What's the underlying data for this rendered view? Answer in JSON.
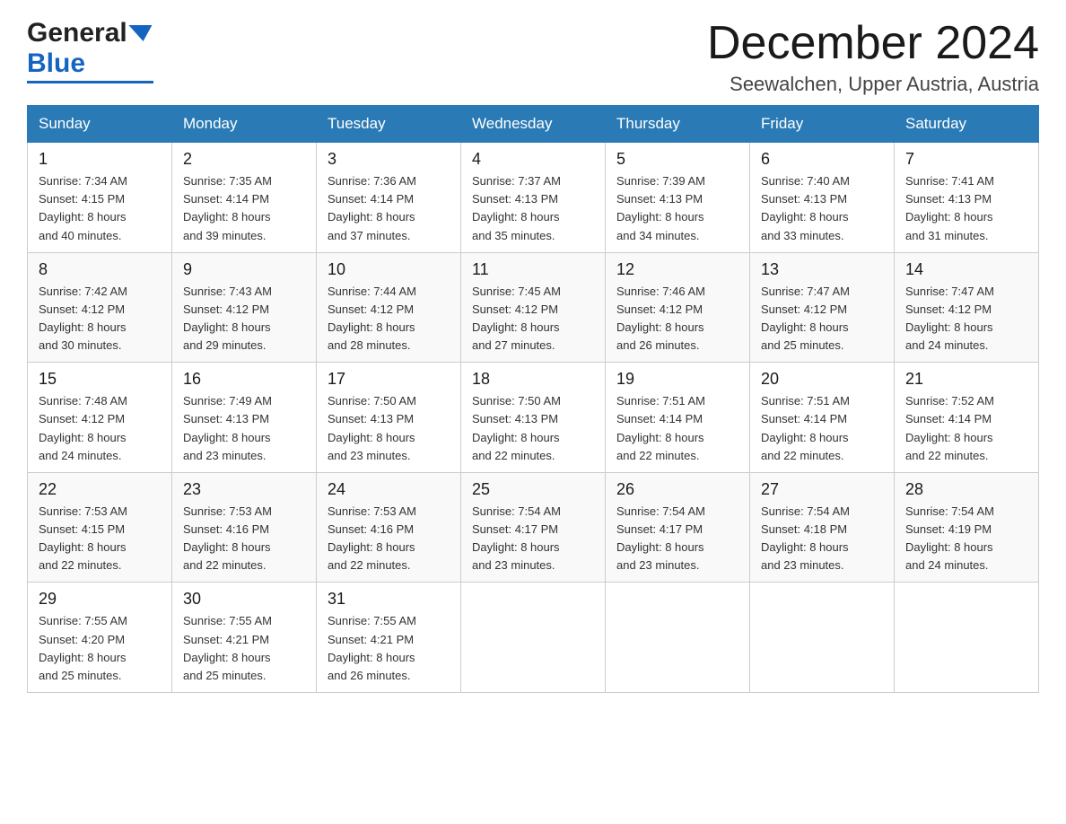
{
  "header": {
    "month_title": "December 2024",
    "location": "Seewalchen, Upper Austria, Austria",
    "logo_general": "General",
    "logo_blue": "Blue"
  },
  "weekdays": [
    "Sunday",
    "Monday",
    "Tuesday",
    "Wednesday",
    "Thursday",
    "Friday",
    "Saturday"
  ],
  "weeks": [
    [
      {
        "day": "1",
        "sunrise": "7:34 AM",
        "sunset": "4:15 PM",
        "daylight": "8 hours and 40 minutes."
      },
      {
        "day": "2",
        "sunrise": "7:35 AM",
        "sunset": "4:14 PM",
        "daylight": "8 hours and 39 minutes."
      },
      {
        "day": "3",
        "sunrise": "7:36 AM",
        "sunset": "4:14 PM",
        "daylight": "8 hours and 37 minutes."
      },
      {
        "day": "4",
        "sunrise": "7:37 AM",
        "sunset": "4:13 PM",
        "daylight": "8 hours and 35 minutes."
      },
      {
        "day": "5",
        "sunrise": "7:39 AM",
        "sunset": "4:13 PM",
        "daylight": "8 hours and 34 minutes."
      },
      {
        "day": "6",
        "sunrise": "7:40 AM",
        "sunset": "4:13 PM",
        "daylight": "8 hours and 33 minutes."
      },
      {
        "day": "7",
        "sunrise": "7:41 AM",
        "sunset": "4:13 PM",
        "daylight": "8 hours and 31 minutes."
      }
    ],
    [
      {
        "day": "8",
        "sunrise": "7:42 AM",
        "sunset": "4:12 PM",
        "daylight": "8 hours and 30 minutes."
      },
      {
        "day": "9",
        "sunrise": "7:43 AM",
        "sunset": "4:12 PM",
        "daylight": "8 hours and 29 minutes."
      },
      {
        "day": "10",
        "sunrise": "7:44 AM",
        "sunset": "4:12 PM",
        "daylight": "8 hours and 28 minutes."
      },
      {
        "day": "11",
        "sunrise": "7:45 AM",
        "sunset": "4:12 PM",
        "daylight": "8 hours and 27 minutes."
      },
      {
        "day": "12",
        "sunrise": "7:46 AM",
        "sunset": "4:12 PM",
        "daylight": "8 hours and 26 minutes."
      },
      {
        "day": "13",
        "sunrise": "7:47 AM",
        "sunset": "4:12 PM",
        "daylight": "8 hours and 25 minutes."
      },
      {
        "day": "14",
        "sunrise": "7:47 AM",
        "sunset": "4:12 PM",
        "daylight": "8 hours and 24 minutes."
      }
    ],
    [
      {
        "day": "15",
        "sunrise": "7:48 AM",
        "sunset": "4:12 PM",
        "daylight": "8 hours and 24 minutes."
      },
      {
        "day": "16",
        "sunrise": "7:49 AM",
        "sunset": "4:13 PM",
        "daylight": "8 hours and 23 minutes."
      },
      {
        "day": "17",
        "sunrise": "7:50 AM",
        "sunset": "4:13 PM",
        "daylight": "8 hours and 23 minutes."
      },
      {
        "day": "18",
        "sunrise": "7:50 AM",
        "sunset": "4:13 PM",
        "daylight": "8 hours and 22 minutes."
      },
      {
        "day": "19",
        "sunrise": "7:51 AM",
        "sunset": "4:14 PM",
        "daylight": "8 hours and 22 minutes."
      },
      {
        "day": "20",
        "sunrise": "7:51 AM",
        "sunset": "4:14 PM",
        "daylight": "8 hours and 22 minutes."
      },
      {
        "day": "21",
        "sunrise": "7:52 AM",
        "sunset": "4:14 PM",
        "daylight": "8 hours and 22 minutes."
      }
    ],
    [
      {
        "day": "22",
        "sunrise": "7:53 AM",
        "sunset": "4:15 PM",
        "daylight": "8 hours and 22 minutes."
      },
      {
        "day": "23",
        "sunrise": "7:53 AM",
        "sunset": "4:16 PM",
        "daylight": "8 hours and 22 minutes."
      },
      {
        "day": "24",
        "sunrise": "7:53 AM",
        "sunset": "4:16 PM",
        "daylight": "8 hours and 22 minutes."
      },
      {
        "day": "25",
        "sunrise": "7:54 AM",
        "sunset": "4:17 PM",
        "daylight": "8 hours and 23 minutes."
      },
      {
        "day": "26",
        "sunrise": "7:54 AM",
        "sunset": "4:17 PM",
        "daylight": "8 hours and 23 minutes."
      },
      {
        "day": "27",
        "sunrise": "7:54 AM",
        "sunset": "4:18 PM",
        "daylight": "8 hours and 23 minutes."
      },
      {
        "day": "28",
        "sunrise": "7:54 AM",
        "sunset": "4:19 PM",
        "daylight": "8 hours and 24 minutes."
      }
    ],
    [
      {
        "day": "29",
        "sunrise": "7:55 AM",
        "sunset": "4:20 PM",
        "daylight": "8 hours and 25 minutes."
      },
      {
        "day": "30",
        "sunrise": "7:55 AM",
        "sunset": "4:21 PM",
        "daylight": "8 hours and 25 minutes."
      },
      {
        "day": "31",
        "sunrise": "7:55 AM",
        "sunset": "4:21 PM",
        "daylight": "8 hours and 26 minutes."
      },
      null,
      null,
      null,
      null
    ]
  ],
  "labels": {
    "sunrise": "Sunrise:",
    "sunset": "Sunset:",
    "daylight": "Daylight:"
  }
}
